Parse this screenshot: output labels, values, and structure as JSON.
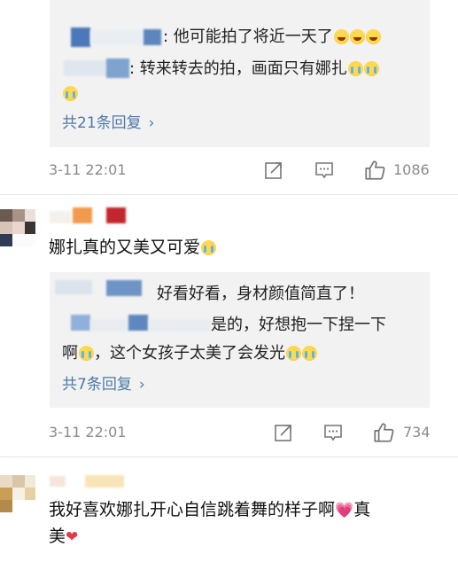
{
  "comments": [
    {
      "replies": [
        {
          "user": "",
          "text": ": 他可能拍了将近一天了",
          "emoji": [
            "laugh",
            "laugh",
            "laugh"
          ]
        },
        {
          "user": "",
          "text": ": 转来转去的拍，画面只有娜扎",
          "emoji": [
            "cry",
            "cry",
            "cry"
          ]
        }
      ],
      "more": "共21条回复",
      "time": "3-11 22:01",
      "likes": "1086"
    },
    {
      "text": "娜扎真的又美又可爱",
      "replies": [
        {
          "text": "好看好看，身材颜值简直了！"
        },
        {
          "text": "是的，好想抱一下捏一下",
          "cont": "啊",
          "cont2": "，这个女孩子太美了会发光"
        }
      ],
      "more": "共7条回复",
      "time": "3-11 22:01",
      "likes": "734"
    },
    {
      "text1": "我好喜欢娜扎开心自信跳着舞的样子啊",
      "text1b": "真",
      "text2": "美"
    }
  ],
  "icons": {
    "share": "share-icon",
    "comment": "comment-icon",
    "like": "thumbs-up-icon"
  }
}
